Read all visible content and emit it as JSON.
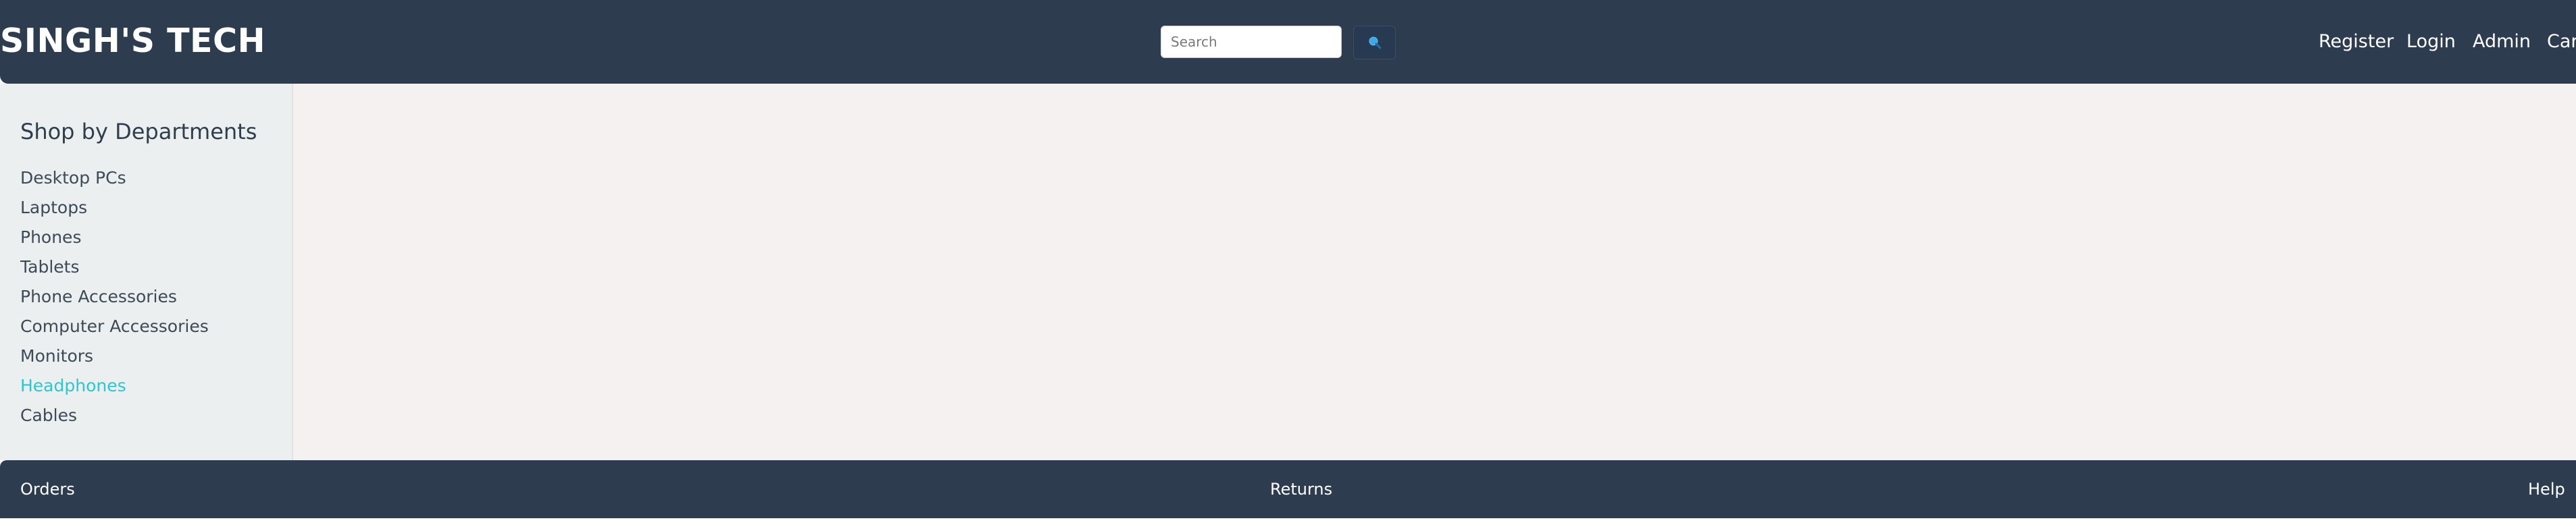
{
  "header": {
    "brand": "SINGH'S TECH",
    "search": {
      "placeholder": "Search",
      "value": "",
      "button_icon": "search-icon"
    },
    "nav": [
      {
        "label": "Register"
      },
      {
        "label": "Login"
      },
      {
        "label": "Admin"
      },
      {
        "label": "Car"
      }
    ]
  },
  "sidebar": {
    "title": "Shop by Departments",
    "items": [
      {
        "label": "Desktop PCs",
        "active": false
      },
      {
        "label": "Laptops",
        "active": false
      },
      {
        "label": "Phones",
        "active": false
      },
      {
        "label": "Tablets",
        "active": false
      },
      {
        "label": "Phone Accessories",
        "active": false
      },
      {
        "label": "Computer Accessories",
        "active": false
      },
      {
        "label": "Monitors",
        "active": false
      },
      {
        "label": "Headphones",
        "active": true
      },
      {
        "label": "Cables",
        "active": false
      }
    ]
  },
  "footer": {
    "links": [
      {
        "label": "Orders"
      },
      {
        "label": "Returns"
      },
      {
        "label": "Help"
      }
    ]
  },
  "colors": {
    "header_bg": "#2e3c4f",
    "sidebar_bg": "#ebefef",
    "main_bg": "#f5f1f0",
    "active_link": "#2cc7cf",
    "search_button_bg": "#283a52"
  }
}
